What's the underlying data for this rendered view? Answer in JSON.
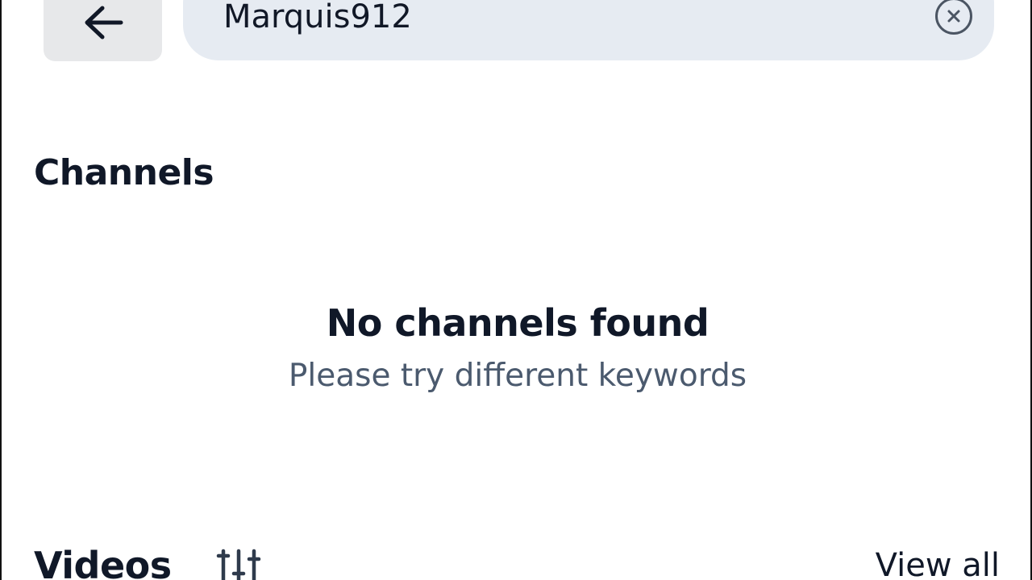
{
  "search": {
    "query": "Marquis912",
    "back_icon": "arrow-left-icon",
    "clear_icon": "close-circle-icon"
  },
  "channels": {
    "title": "Channels",
    "empty_title": "No channels found",
    "empty_subtitle": "Please try different keywords"
  },
  "videos": {
    "title": "Videos",
    "filter_icon": "sliders-icon",
    "view_all_label": "View all"
  },
  "colors": {
    "search_background": "#e6ebf2",
    "back_button_background": "#e7e8ea",
    "heading_text": "#101828",
    "secondary_text": "#4b5a6e"
  }
}
